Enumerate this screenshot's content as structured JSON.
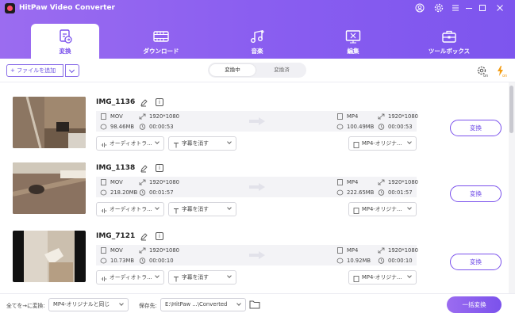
{
  "app": {
    "title": "HitPaw Video Converter"
  },
  "tabs": [
    {
      "label": "変換",
      "icon": "convert-icon",
      "active": true
    },
    {
      "label": "ダウンロード",
      "icon": "download-film-icon",
      "active": false
    },
    {
      "label": "音楽",
      "icon": "music-icon",
      "active": false
    },
    {
      "label": "編集",
      "icon": "edit-screen-icon",
      "active": false
    },
    {
      "label": "ツールボックス",
      "icon": "toolbox-icon",
      "active": false
    }
  ],
  "toolbar": {
    "add_file_label": "+ ファイルを追加",
    "segment": [
      "変換中",
      "変換済"
    ],
    "segment_active": 0,
    "accent_color": "#7b52ec",
    "gpu_icon_color": "#f39c12"
  },
  "items": [
    {
      "name": "IMG_1136",
      "src": {
        "format": "MOV",
        "resolution": "1920*1080",
        "size": "98.46MB",
        "duration": "00:00:53"
      },
      "dst": {
        "format": "MP4",
        "resolution": "1920*1080",
        "size": "100.49MB",
        "duration": "00:00:53"
      },
      "audio": "オーディオトラ...",
      "subtitle": "字幕を消す",
      "output": "MP4-オリジナ...",
      "convert_label": "変換"
    },
    {
      "name": "IMG_1138",
      "src": {
        "format": "MOV",
        "resolution": "1920*1080",
        "size": "218.20MB",
        "duration": "00:01:57"
      },
      "dst": {
        "format": "MP4",
        "resolution": "1920*1080",
        "size": "222.65MB",
        "duration": "00:01:57"
      },
      "audio": "オーディオトラ...",
      "subtitle": "字幕を消す",
      "output": "MP4-オリジナ...",
      "convert_label": "変換"
    },
    {
      "name": "IMG_7121",
      "src": {
        "format": "MOV",
        "resolution": "1920*1080",
        "size": "10.73MB",
        "duration": "00:00:10"
      },
      "dst": {
        "format": "MP4",
        "resolution": "1920*1080",
        "size": "10.92MB",
        "duration": "00:00:10"
      },
      "audio": "オーディオトラ...",
      "subtitle": "字幕を消す",
      "output": "MP4-オリジナ...",
      "convert_label": "変換"
    }
  ],
  "footer": {
    "convert_all_to_label": "全てを→に変換:",
    "convert_all_to_value": "MP4-オリジナルと同じ",
    "save_to_label": "保存先:",
    "save_to_value": "E:\\HitPaw ...\\Converted",
    "convert_all_button": "一括変換"
  }
}
